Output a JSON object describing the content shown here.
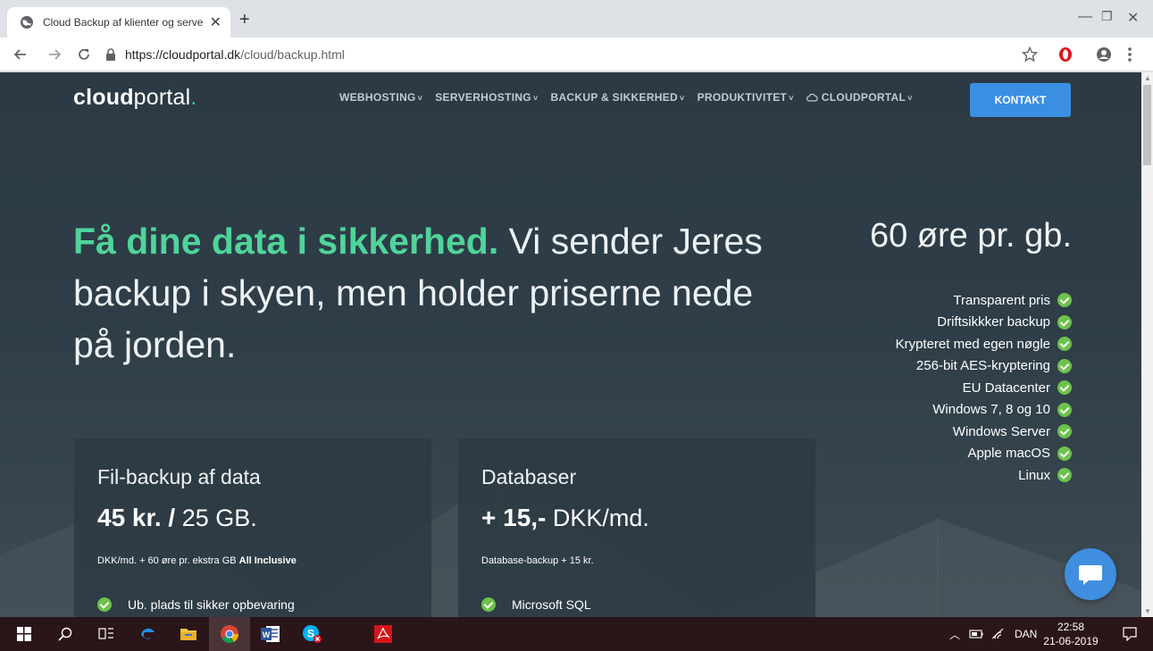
{
  "browser": {
    "tab_title": "Cloud Backup af klienter og serve",
    "tab_close": "✕",
    "new_tab": "+",
    "url_domain": "https://cloudportal.dk",
    "url_path": "/cloud/backup.html",
    "window_controls": [
      "—",
      "❐",
      "✕"
    ],
    "icons": [
      "globe-icon",
      "back-icon",
      "forward-icon",
      "reload-icon",
      "lock-icon",
      "star-icon",
      "opera-icon",
      "account-icon",
      "menu-icon"
    ]
  },
  "site": {
    "logo_bold": "cloud",
    "logo_light": "portal",
    "logo_dot": ".",
    "nav": [
      {
        "label": "WEBHOSTING"
      },
      {
        "label": "SERVERHOSTING"
      },
      {
        "label": "BACKUP & SIKKERHED"
      },
      {
        "label": "PRODUKTIVITET"
      },
      {
        "label": "CLOUDPORTAL"
      }
    ],
    "nav_chevron": "˅",
    "contact_button": "KONTAKT"
  },
  "hero": {
    "highlight": "Få dine data i sikkerhed.",
    "rest": " Vi sender Jeres backup i skyen, men holder priserne nede på jorden."
  },
  "pricing": {
    "headline": "60 øre pr. gb.",
    "features": [
      "Transparent pris",
      "Driftsikkker backup",
      "Krypteret med egen nøgle",
      "256-bit AES-kryptering",
      "EU Datacenter",
      "Windows 7, 8 og 10",
      "Windows Server",
      "Apple macOS",
      "Linux"
    ]
  },
  "cards": [
    {
      "title": "Fil-backup af data",
      "price_bold": "45 kr. /",
      "price_rest": " 25 GB.",
      "note": "DKK/md. + 60 øre pr. ekstra GB ",
      "note_bold": "All Inclusive",
      "item": "Ub. plads til sikker opbevaring"
    },
    {
      "title": "Databaser",
      "price_bold": "+ 15,-",
      "price_rest": " DKK/md.",
      "note": "Database-backup + 15 kr.",
      "note_bold": "",
      "item": "Microsoft SQL"
    }
  ],
  "taskbar": {
    "language": "DAN",
    "time": "22:58",
    "date": "21-06-2019"
  },
  "colors": {
    "accent_green": "#4fd49b",
    "button_blue": "#3b8fe3",
    "check_green": "#6cc24a",
    "page_bg": "#2e3d47",
    "taskbar_bg": "#2a1518"
  }
}
